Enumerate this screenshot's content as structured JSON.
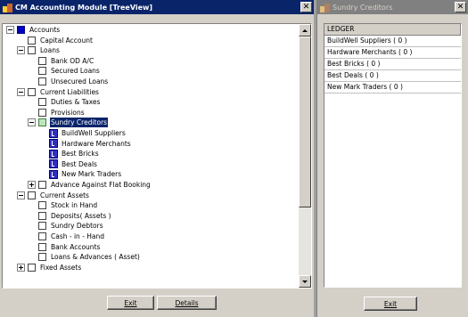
{
  "left_window": {
    "title": "CM Accounting Module [TreeView]",
    "close_glyph": "✕",
    "exit_label": "Exit",
    "details_label": "Details",
    "tree": [
      {
        "label": "Accounts",
        "level": 0,
        "icon": "blue-folder-icon",
        "expander": "minus"
      },
      {
        "label": "Capital Account",
        "level": 1,
        "icon": "folder-icon",
        "expander": "none"
      },
      {
        "label": "Loans",
        "level": 1,
        "icon": "folder-icon",
        "expander": "minus"
      },
      {
        "label": "Bank OD A/C",
        "level": 2,
        "icon": "folder-icon",
        "expander": "none"
      },
      {
        "label": "Secured Loans",
        "level": 2,
        "icon": "folder-icon",
        "expander": "none"
      },
      {
        "label": "Unsecured Loans",
        "level": 2,
        "icon": "folder-icon",
        "expander": "none"
      },
      {
        "label": "Current Liabilities",
        "level": 1,
        "icon": "folder-icon",
        "expander": "minus"
      },
      {
        "label": "Duties & Taxes",
        "level": 2,
        "icon": "folder-icon",
        "expander": "none"
      },
      {
        "label": "Provisions",
        "level": 2,
        "icon": "folder-icon",
        "expander": "none"
      },
      {
        "label": "Sundry Creditors",
        "level": 2,
        "icon": "green-folder-icon",
        "expander": "minus",
        "selected": true
      },
      {
        "label": "BuildWell Suppliers",
        "level": 3,
        "icon": "ledger-icon",
        "expander": "none"
      },
      {
        "label": "Hardware Merchants",
        "level": 3,
        "icon": "ledger-icon",
        "expander": "none"
      },
      {
        "label": "Best Bricks",
        "level": 3,
        "icon": "ledger-icon",
        "expander": "none"
      },
      {
        "label": "Best Deals",
        "level": 3,
        "icon": "ledger-icon",
        "expander": "none"
      },
      {
        "label": "New Mark Traders",
        "level": 3,
        "icon": "ledger-icon",
        "expander": "none"
      },
      {
        "label": "Advance Against Flat Booking",
        "level": 2,
        "icon": "folder-icon",
        "expander": "plus"
      },
      {
        "label": "Current Assets",
        "level": 1,
        "icon": "folder-icon",
        "expander": "minus"
      },
      {
        "label": "Stock in Hand",
        "level": 2,
        "icon": "folder-icon",
        "expander": "none"
      },
      {
        "label": "Deposits( Assets )",
        "level": 2,
        "icon": "folder-icon",
        "expander": "none"
      },
      {
        "label": "Sundry Debtors",
        "level": 2,
        "icon": "folder-icon",
        "expander": "none"
      },
      {
        "label": "Cash - in - Hand",
        "level": 2,
        "icon": "folder-icon",
        "expander": "none"
      },
      {
        "label": "Bank Accounts",
        "level": 2,
        "icon": "folder-icon",
        "expander": "none"
      },
      {
        "label": "Loans & Advances ( Asset)",
        "level": 2,
        "icon": "folder-icon",
        "expander": "none"
      },
      {
        "label": "Fixed Assets",
        "level": 1,
        "icon": "folder-icon",
        "expander": "plus"
      }
    ]
  },
  "right_window": {
    "title": "Sundry Creditors",
    "close_glyph": "✕",
    "column_header": "LEDGER",
    "rows": [
      "BuildWell Suppliers ( 0 )",
      "Hardware Merchants ( 0 )",
      "Best Bricks ( 0 )",
      "Best Deals ( 0 )",
      "New Mark Traders ( 0 )"
    ],
    "exit_label": "Exit"
  },
  "colors": {
    "active_title": "#0a246a",
    "inactive_title": "#808080",
    "selection": "#0a246a",
    "face": "#d4d0c8"
  }
}
